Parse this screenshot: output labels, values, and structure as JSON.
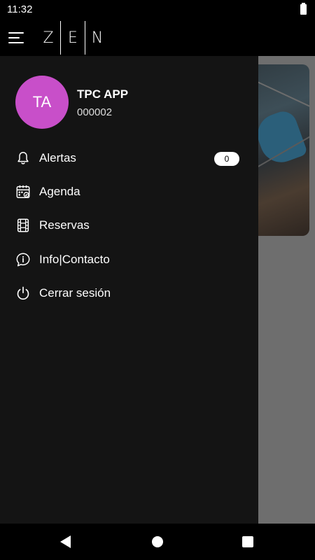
{
  "status_bar": {
    "time": "11:32"
  },
  "app_bar": {
    "logo_letters": [
      "Z",
      "E",
      "N"
    ]
  },
  "drawer": {
    "user": {
      "initials": "TA",
      "name": "TPC APP",
      "id": "000002"
    },
    "items": [
      {
        "label": "Alertas",
        "icon": "bell-icon",
        "badge": "0"
      },
      {
        "label": "Agenda",
        "icon": "calendar-check-icon"
      },
      {
        "label": "Reservas",
        "icon": "film-strip-icon"
      },
      {
        "label": "Info|Contacto",
        "icon": "info-bubble-icon"
      },
      {
        "label": "Cerrar sesión",
        "icon": "power-icon"
      }
    ]
  },
  "colors": {
    "avatar": "#c84fc9",
    "drawer_bg": "#141414",
    "scrim": "#6e6e6e"
  }
}
